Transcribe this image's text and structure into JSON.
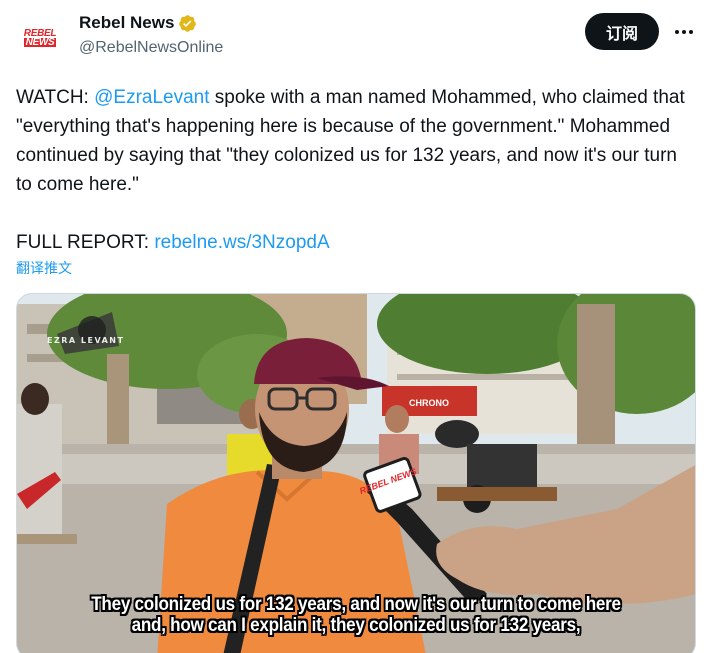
{
  "account": {
    "logo_line1": "REBEL",
    "logo_line2": "NEWS",
    "display_name": "Rebel News",
    "handle": "@RebelNewsOnline",
    "verified_icon": "gold-verified-badge"
  },
  "header_actions": {
    "subscribe_label": "订阅",
    "more_icon": "more-dots-icon"
  },
  "tweet": {
    "prefix": "WATCH: ",
    "mention": "@EzraLevant",
    "body_after_mention": " spoke with a man named Mohammed, who claimed that \"everything that's happening here is because of the government.\" Mohammed continued by saying that \"they colonized us for 132 years, and now it's our turn to come here.\"",
    "report_label": "FULL REPORT: ",
    "report_link": "rebelne.ws/3NzopdA"
  },
  "translate_label": "翻译推文",
  "media": {
    "watermark": "EZRA LEVANT",
    "mic_logo": "REBEL NEWS",
    "shop_sign": "CHRONO",
    "sign_letter": "P",
    "subtitle_line1": "They colonized us for 132 years, and now it's our turn to come here",
    "subtitle_line2": "and, how can I explain it, they colonized us for 132 years,"
  },
  "colors": {
    "link": "#1d9bf0",
    "button_bg": "#0f1419",
    "brand_red": "#e0262b",
    "verified_gold": "#e2b719"
  }
}
